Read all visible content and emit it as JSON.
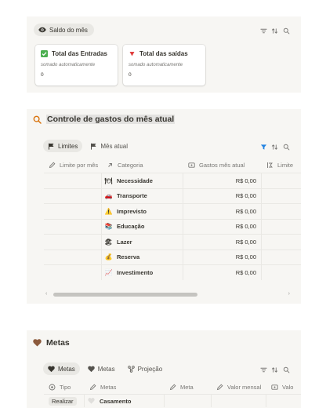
{
  "saldo": {
    "pill_label": "Saldo do mês",
    "cards": [
      {
        "title": "Total das Entradas",
        "subtitle": "somado automaticamente",
        "value": "0",
        "icon": "checkbox-green-icon"
      },
      {
        "title": "Total das saídas",
        "subtitle": "somado automaticamente",
        "value": "0",
        "icon": "red-triangle-icon"
      }
    ]
  },
  "controle": {
    "title": "Controle de gastos do mês atual",
    "tabs": [
      {
        "label": "Limites",
        "active": true
      },
      {
        "label": "Mês atual",
        "active": false
      }
    ],
    "columns": [
      "Limite por mês",
      "Categoria",
      "Gastos mês atual",
      "Limite"
    ],
    "rows": [
      {
        "emoji": "🍽",
        "category": "Necessidade",
        "gastos": "R$ 0,00"
      },
      {
        "emoji": "🚗",
        "category": "Transporte",
        "gastos": "R$ 0,00"
      },
      {
        "emoji": "⚠️",
        "category": "Imprevisto",
        "gastos": "R$ 0,00"
      },
      {
        "emoji": "📚",
        "category": "Educação",
        "gastos": "R$ 0,00"
      },
      {
        "emoji": "🏖",
        "category": "Lazer",
        "gastos": "R$ 0,00"
      },
      {
        "emoji": "💰",
        "category": "Reserva",
        "gastos": "R$ 0,00"
      },
      {
        "emoji": "📈",
        "category": "Investimento",
        "gastos": "R$ 0,00"
      }
    ],
    "accent_color": "#2383e2"
  },
  "metas": {
    "title": "Metas",
    "tabs": [
      {
        "label": "Metas",
        "active": true
      },
      {
        "label": "Metas",
        "active": false
      },
      {
        "label": "Projeção",
        "active": false
      }
    ],
    "columns": [
      "Tipo",
      "Metas",
      "Meta",
      "Valor mensal",
      "Valo"
    ],
    "rows": [
      {
        "tipo": "Realizar",
        "meta": "Casamento"
      }
    ],
    "heart_color": "#8c5a3c"
  }
}
